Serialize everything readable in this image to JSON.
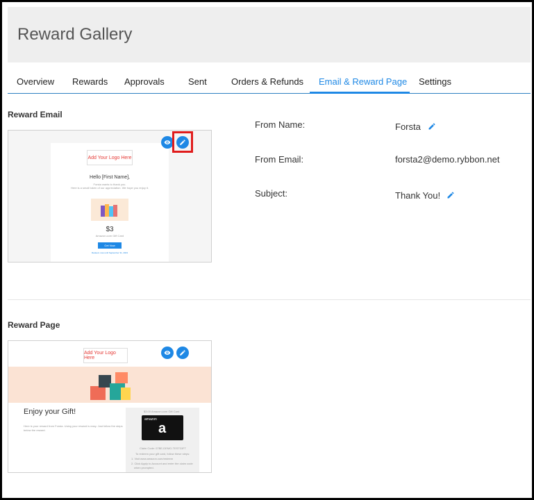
{
  "header": {
    "title": "Reward Gallery"
  },
  "tabs": [
    {
      "label": "Overview"
    },
    {
      "label": "Rewards"
    },
    {
      "label": "Approvals"
    },
    {
      "label": "Sent"
    },
    {
      "label": "Orders & Refunds"
    },
    {
      "label": "Email & Reward Page",
      "active": true
    },
    {
      "label": "Settings"
    }
  ],
  "reward_email": {
    "section_title": "Reward Email",
    "preview": {
      "logo_text": "Add Your Logo Here",
      "greeting": "Hello [First Name],",
      "message_line1": "Forsta wants to thank you.",
      "message_line2": "Here is a small token of our appreciation. We hope you enjoy it.",
      "amount": "$3",
      "card_name": "Amazon.com Gift Card",
      "cta": "Get Now",
      "expiry": "Redeem now until September 31, 2023"
    },
    "fields": [
      {
        "label": "From Name:",
        "value": "Forsta",
        "editable": true
      },
      {
        "label": "From Email:",
        "value": "forsta2@demo.rybbon.net",
        "editable": false
      },
      {
        "label": "Subject:",
        "value": "Thank You!",
        "editable": true
      }
    ]
  },
  "reward_page": {
    "section_title": "Reward Page",
    "preview": {
      "logo_text": "Add Your Logo Here",
      "heading": "Enjoy your Gift!",
      "body_line1": "Here is your reward from Forsta. Using your reward is easy. Just follow the steps",
      "body_line2": "below the reward.",
      "card_title": "$3.00 Amazon.com Gift Card",
      "card_brand": "amazon",
      "claim_code": "Claim Code: 07BE-DEMO-TESTGIFT",
      "steps_intro": "To redeem your gift card, follow these steps:",
      "step1": "1. Visit www.amazon.com/redeem",
      "step2": "2. Click Apply to Account and enter the claim code",
      "step3": "when prompted."
    }
  },
  "colors": {
    "accent": "#1e88e5",
    "highlight": "#e01b1b",
    "header_bg": "#eeeeee"
  }
}
